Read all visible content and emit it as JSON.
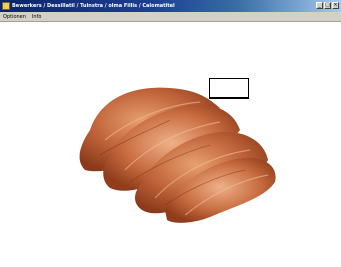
{
  "window": {
    "title": "Bewerkers / Dessillatil / Tuinstra / olma Fillis / Calomatitel"
  },
  "menubar": {
    "items": [
      "Optionen",
      "Info"
    ]
  },
  "titlebar_buttons": {
    "minimize": "_",
    "maximize": "□",
    "close": "×"
  },
  "image": {
    "icon": "meat-cutlets-image"
  },
  "colors": {
    "titlebar_start": "#0a246a",
    "titlebar_end": "#a6caf0",
    "menubar_bg": "#d4d0c8",
    "meat_main": "#b4532a"
  }
}
